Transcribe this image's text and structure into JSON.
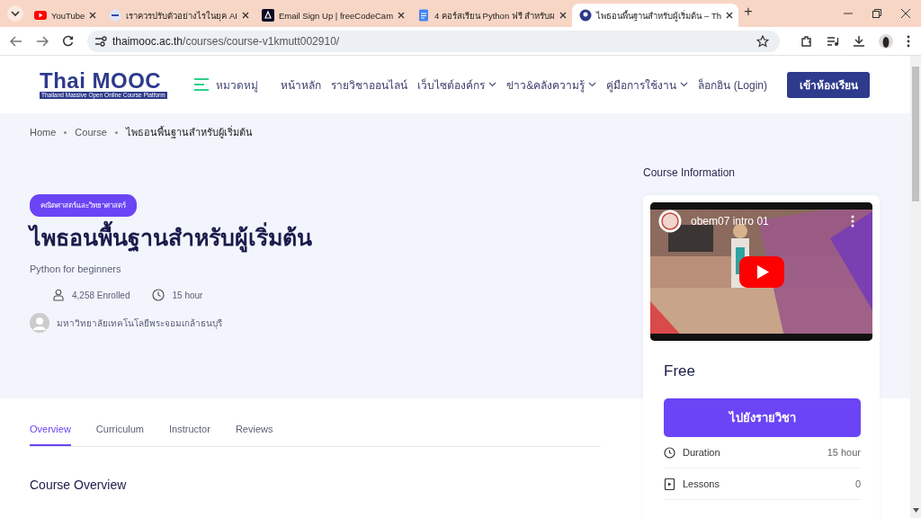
{
  "browser": {
    "tabs": [
      {
        "title": "YouTube",
        "selected": false
      },
      {
        "title": "เราควรปรับตัวอย่างไรในยุค AI",
        "selected": false
      },
      {
        "title": "Email Sign Up | freeCodeCam",
        "selected": false
      },
      {
        "title": "4 คอร์สเรียน Python ฟรี สำหรับผ",
        "selected": false
      },
      {
        "title": "ไพธอนพื้นฐานสำหรับผู้เริ่มต้น – Th",
        "selected": true
      }
    ],
    "new_tab": "+",
    "url_host": "thaimooc.ac.th",
    "url_path": "/courses/course-v1kmutt002910/"
  },
  "header": {
    "logo": "Thai MOOC",
    "logo_tagline": "Thailand Massive Open Online Course Platform",
    "categories": "หมวดหมู่",
    "nav": [
      {
        "label": "หน้าหลัก",
        "dropdown": false
      },
      {
        "label": "รายวิชาออนไลน์",
        "dropdown": false
      },
      {
        "label": "เว็บไซต์องค์กร",
        "dropdown": true
      },
      {
        "label": "ข่าว&คลังความรู้",
        "dropdown": true
      },
      {
        "label": "คู่มือการใช้งาน",
        "dropdown": true
      },
      {
        "label": "ล็อกอิน (Login)",
        "dropdown": false
      }
    ],
    "cta": "เข้าห้องเรียน"
  },
  "breadcrumb": [
    {
      "label": "Home",
      "current": false
    },
    {
      "label": "Course",
      "current": false
    },
    {
      "label": "ไพธอนพื้นฐานสำหรับผู้เริ่มต้น",
      "current": true
    }
  ],
  "course": {
    "category": "คณิตศาสตร์และวิทยาศาสตร์",
    "title": "ไพธอนพื้นฐานสำหรับผู้เริ่มต้น",
    "subtitle": "Python for beginners",
    "enrolled": "4,258 Enrolled",
    "duration": "15 hour",
    "institution": "มหาวิทยาลัยเทคโนโลยีพระจอมเกล้าธนบุรี"
  },
  "tabs": [
    {
      "label": "Overview",
      "selected": true
    },
    {
      "label": "Curriculum",
      "selected": false
    },
    {
      "label": "Instructor",
      "selected": false
    },
    {
      "label": "Reviews",
      "selected": false
    }
  ],
  "overview_heading": "Course Overview",
  "info": {
    "heading": "Course Information",
    "video": {
      "kind": "picture",
      "title": "obem07 intro 01"
    },
    "price": "Free",
    "button": "ไปยังรายวิชา",
    "rows": [
      {
        "label": "Duration",
        "value": "15 hour"
      },
      {
        "label": "Lessons",
        "value": "0"
      }
    ]
  }
}
